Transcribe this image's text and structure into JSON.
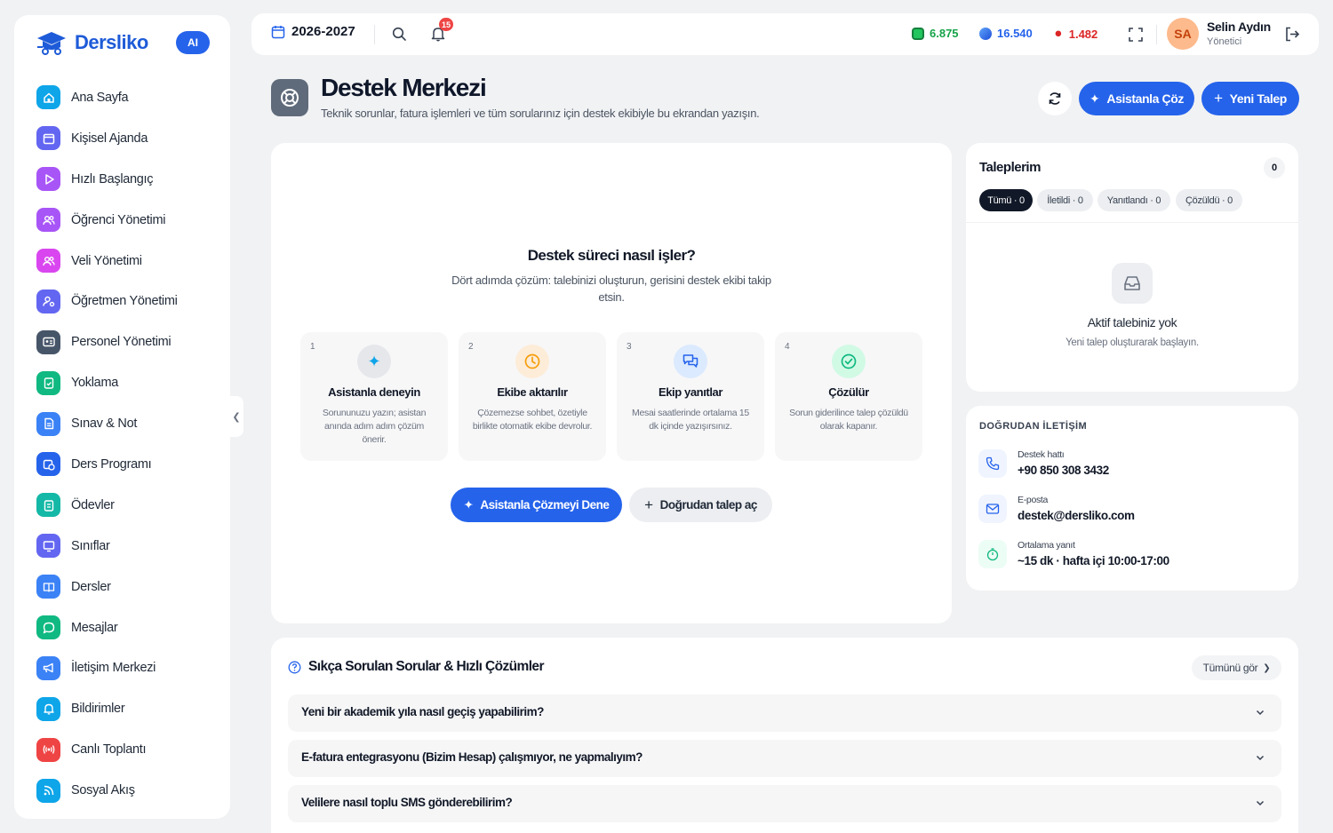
{
  "brand": {
    "name": "Dersliko",
    "ai_badge": "AI"
  },
  "sidebar": {
    "items": [
      {
        "label": "Ana Sayfa",
        "icon": "home-icon",
        "color": "#0ea5e9"
      },
      {
        "label": "Kişisel Ajanda",
        "icon": "calendar-icon",
        "color": "#6366f1"
      },
      {
        "label": "Hızlı Başlangıç",
        "icon": "play-icon",
        "color": "#a855f7"
      },
      {
        "label": "Öğrenci Yönetimi",
        "icon": "users-icon",
        "color": "#a855f7"
      },
      {
        "label": "Veli Yönetimi",
        "icon": "users-icon",
        "color": "#d946ef"
      },
      {
        "label": "Öğretmen Yönetimi",
        "icon": "user-cog-icon",
        "color": "#6366f1"
      },
      {
        "label": "Personel Yönetimi",
        "icon": "id-card-icon",
        "color": "#475569"
      },
      {
        "label": "Yoklama",
        "icon": "clipboard-check-icon",
        "color": "#10b981"
      },
      {
        "label": "Sınav & Not",
        "icon": "file-icon",
        "color": "#3b82f6"
      },
      {
        "label": "Ders Programı",
        "icon": "calendar-clock-icon",
        "color": "#2563eb"
      },
      {
        "label": "Ödevler",
        "icon": "clipboard-icon",
        "color": "#14b8a6"
      },
      {
        "label": "Sınıflar",
        "icon": "monitor-icon",
        "color": "#6366f1"
      },
      {
        "label": "Dersler",
        "icon": "book-icon",
        "color": "#3b82f6"
      },
      {
        "label": "Mesajlar",
        "icon": "chat-icon",
        "color": "#10b981"
      },
      {
        "label": "İletişim Merkezi",
        "icon": "megaphone-icon",
        "color": "#3b82f6"
      },
      {
        "label": "Bildirimler",
        "icon": "bell-icon",
        "color": "#0ea5e9"
      },
      {
        "label": "Canlı Toplantı",
        "icon": "broadcast-icon",
        "color": "#ef4444"
      },
      {
        "label": "Sosyal Akış",
        "icon": "rss-icon",
        "color": "#0ea5e9"
      }
    ]
  },
  "topbar": {
    "year": "2026-2027",
    "notifications_count": "15",
    "stats": [
      {
        "value": "6.875",
        "color": "#16a34a",
        "icon": "green-gem-icon"
      },
      {
        "value": "16.540",
        "color": "#2563eb",
        "icon": "blue-gem-icon"
      },
      {
        "value": "1.482",
        "color": "#dc2626",
        "icon": "flame-icon"
      }
    ],
    "user": {
      "initials": "SA",
      "name": "Selin Aydın",
      "role": "Yönetici"
    }
  },
  "page": {
    "title": "Destek Merkezi",
    "subtitle": "Teknik sorunlar, fatura işlemleri ve tüm sorularınız için destek ekibiyle bu ekrandan yazışın.",
    "btn_assistant": "Asistanla Çöz",
    "btn_new": "Yeni Talep"
  },
  "process": {
    "title": "Destek süreci nasıl işler?",
    "subtitle": "Dört adımda çözüm: talebinizi oluşturun, gerisini destek ekibi takip etsin.",
    "steps": [
      {
        "num": "1",
        "title": "Asistanla deneyin",
        "desc": "Sorununuzu yazın; asistan anında adım adım çözüm önerir.",
        "icon": "sparkle-icon"
      },
      {
        "num": "2",
        "title": "Ekibe aktarılır",
        "desc": "Çözemezse sohbet, özetiyle birlikte otomatik ekibe devrolur.",
        "icon": "clock-icon"
      },
      {
        "num": "3",
        "title": "Ekip yanıtlar",
        "desc": "Mesai saatlerinde ortalama 15 dk içinde yazışırsınız.",
        "icon": "chat-icon"
      },
      {
        "num": "4",
        "title": "Çözülür",
        "desc": "Sorun giderilince talep çözüldü olarak kapanır.",
        "icon": "check-circle-icon"
      }
    ],
    "btn_try": "Asistanla Çözmeyi Dene",
    "btn_direct": "Doğrudan talep aç"
  },
  "requests": {
    "title": "Taleplerim",
    "count": "0",
    "filters": [
      "Tümü · 0",
      "İletildi · 0",
      "Yanıtlandı · 0",
      "Çözüldü · 0"
    ],
    "empty_title": "Aktif talebiniz yok",
    "empty_sub": "Yeni talep oluşturarak başlayın."
  },
  "contact": {
    "heading": "DOĞRUDAN İLETİŞİM",
    "items": [
      {
        "label": "Destek hattı",
        "value": "+90 850 308 3432",
        "icon": "phone-icon"
      },
      {
        "label": "E-posta",
        "value": "destek@dersliko.com",
        "icon": "mail-icon"
      },
      {
        "label": "Ortalama yanıt",
        "value": "~15 dk · hafta içi 10:00-17:00",
        "icon": "timer-icon"
      }
    ]
  },
  "faq": {
    "title": "Sıkça Sorulan Sorular & Hızlı Çözümler",
    "see_all": "Tümünü gör",
    "items": [
      "Yeni bir akademik yıla nasıl geçiş yapabilirim?",
      "E-fatura entegrasyonu (Bizim Hesap) çalışmıyor, ne yapmalıyım?",
      "Velilere nasıl toplu SMS gönderebilirim?"
    ]
  }
}
